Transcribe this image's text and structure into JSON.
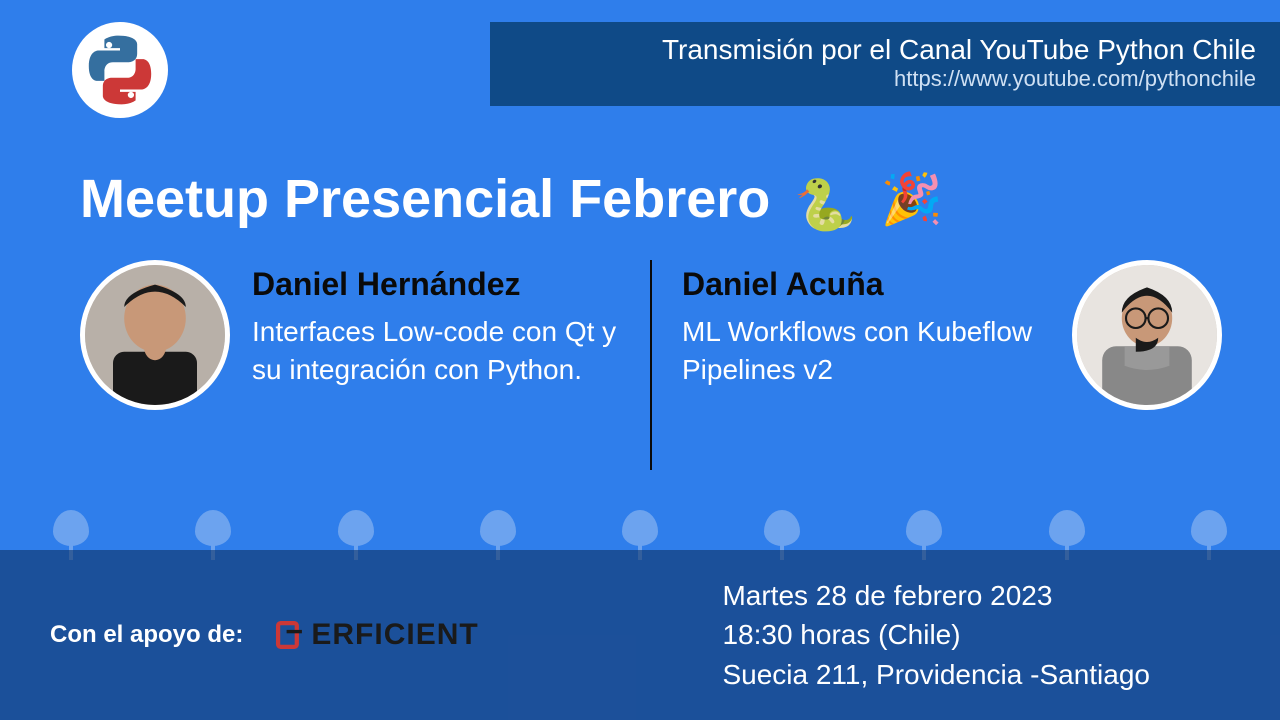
{
  "banner": {
    "title": "Transmisión por el Canal YouTube Python Chile",
    "link": "https://www.youtube.com/pythonchile"
  },
  "title": "Meetup Presencial Febrero",
  "emoji_snake": "🐍",
  "emoji_party": "🎉",
  "speakers": [
    {
      "name": "Daniel Hernández",
      "talk": "Interfaces Low-code con Qt y su integración con Python."
    },
    {
      "name": "Daniel Acuña",
      "talk": "ML Workflows con Kubeflow Pipelines v2"
    }
  ],
  "footer": {
    "support_label": "Con el apoyo de:",
    "sponsor_name": "ERFICIENT",
    "event_date": "Martes 28 de febrero 2023",
    "event_time": "18:30 horas (Chile)",
    "event_location": "Suecia 211, Providencia -Santiago"
  }
}
